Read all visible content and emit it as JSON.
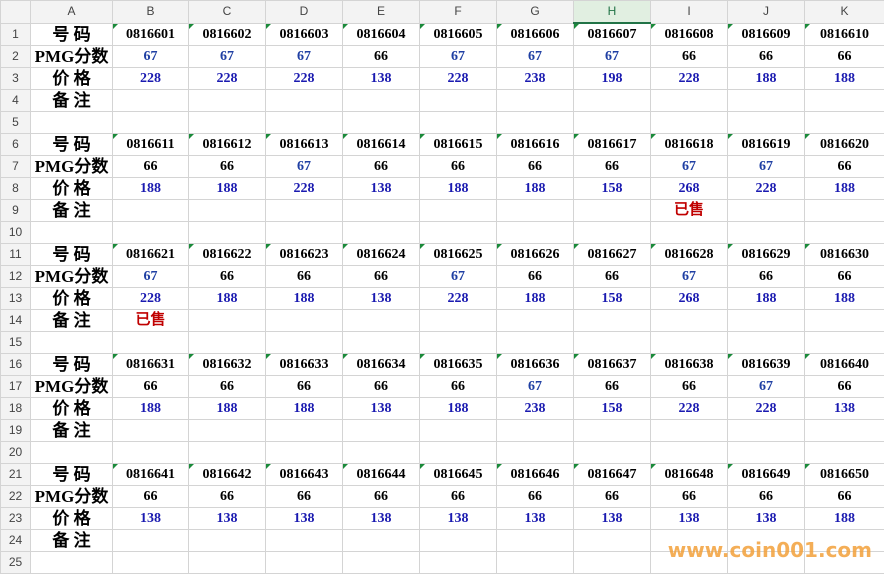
{
  "columns": [
    "",
    "A",
    "B",
    "C",
    "D",
    "E",
    "F",
    "G",
    "H",
    "I",
    "J",
    "K"
  ],
  "selected_column": "H",
  "labels": {
    "number": "号 码",
    "score": "PMG分数",
    "price": "价 格",
    "note": "备 注"
  },
  "blocks": [
    {
      "numbers": [
        "0816601",
        "0816602",
        "0816603",
        "0816604",
        "0816605",
        "0816606",
        "0816607",
        "0816608",
        "0816609",
        "0816610"
      ],
      "scores": [
        "67",
        "67",
        "67",
        "66",
        "67",
        "67",
        "67",
        "66",
        "66",
        "66"
      ],
      "prices": [
        "228",
        "228",
        "228",
        "138",
        "228",
        "238",
        "198",
        "228",
        "188",
        "188"
      ],
      "notes": [
        "",
        "",
        "",
        "",
        "",
        "",
        "",
        "",
        "",
        ""
      ]
    },
    {
      "numbers": [
        "0816611",
        "0816612",
        "0816613",
        "0816614",
        "0816615",
        "0816616",
        "0816617",
        "0816618",
        "0816619",
        "0816620"
      ],
      "scores": [
        "66",
        "66",
        "67",
        "66",
        "66",
        "66",
        "66",
        "67",
        "67",
        "66"
      ],
      "prices": [
        "188",
        "188",
        "228",
        "138",
        "188",
        "188",
        "158",
        "268",
        "228",
        "188"
      ],
      "notes": [
        "",
        "",
        "",
        "",
        "",
        "",
        "",
        "已售",
        "",
        ""
      ]
    },
    {
      "numbers": [
        "0816621",
        "0816622",
        "0816623",
        "0816624",
        "0816625",
        "0816626",
        "0816627",
        "0816628",
        "0816629",
        "0816630"
      ],
      "scores": [
        "67",
        "66",
        "66",
        "66",
        "67",
        "66",
        "66",
        "67",
        "66",
        "66"
      ],
      "prices": [
        "228",
        "188",
        "188",
        "138",
        "228",
        "188",
        "158",
        "268",
        "188",
        "188"
      ],
      "notes": [
        "已售",
        "",
        "",
        "",
        "",
        "",
        "",
        "",
        "",
        ""
      ]
    },
    {
      "numbers": [
        "0816631",
        "0816632",
        "0816633",
        "0816634",
        "0816635",
        "0816636",
        "0816637",
        "0816638",
        "0816639",
        "0816640"
      ],
      "scores": [
        "66",
        "66",
        "66",
        "66",
        "66",
        "67",
        "66",
        "66",
        "67",
        "66"
      ],
      "prices": [
        "188",
        "188",
        "188",
        "138",
        "188",
        "238",
        "158",
        "228",
        "228",
        "138"
      ],
      "notes": [
        "",
        "",
        "",
        "",
        "",
        "",
        "",
        "",
        "",
        ""
      ]
    },
    {
      "numbers": [
        "0816641",
        "0816642",
        "0816643",
        "0816644",
        "0816645",
        "0816646",
        "0816647",
        "0816648",
        "0816649",
        "0816650"
      ],
      "scores": [
        "66",
        "66",
        "66",
        "66",
        "66",
        "66",
        "66",
        "66",
        "66",
        "66"
      ],
      "prices": [
        "138",
        "138",
        "138",
        "138",
        "138",
        "138",
        "138",
        "138",
        "138",
        "188"
      ],
      "notes": [
        "",
        "",
        "",
        "",
        "",
        "",
        "",
        "",
        "",
        ""
      ]
    }
  ],
  "watermark": "www.coin001.com",
  "colors": {
    "price": "#1a1ab0",
    "sold": "#c00000",
    "high_score": "#1f3fa3",
    "watermark": "#f3a13a"
  }
}
